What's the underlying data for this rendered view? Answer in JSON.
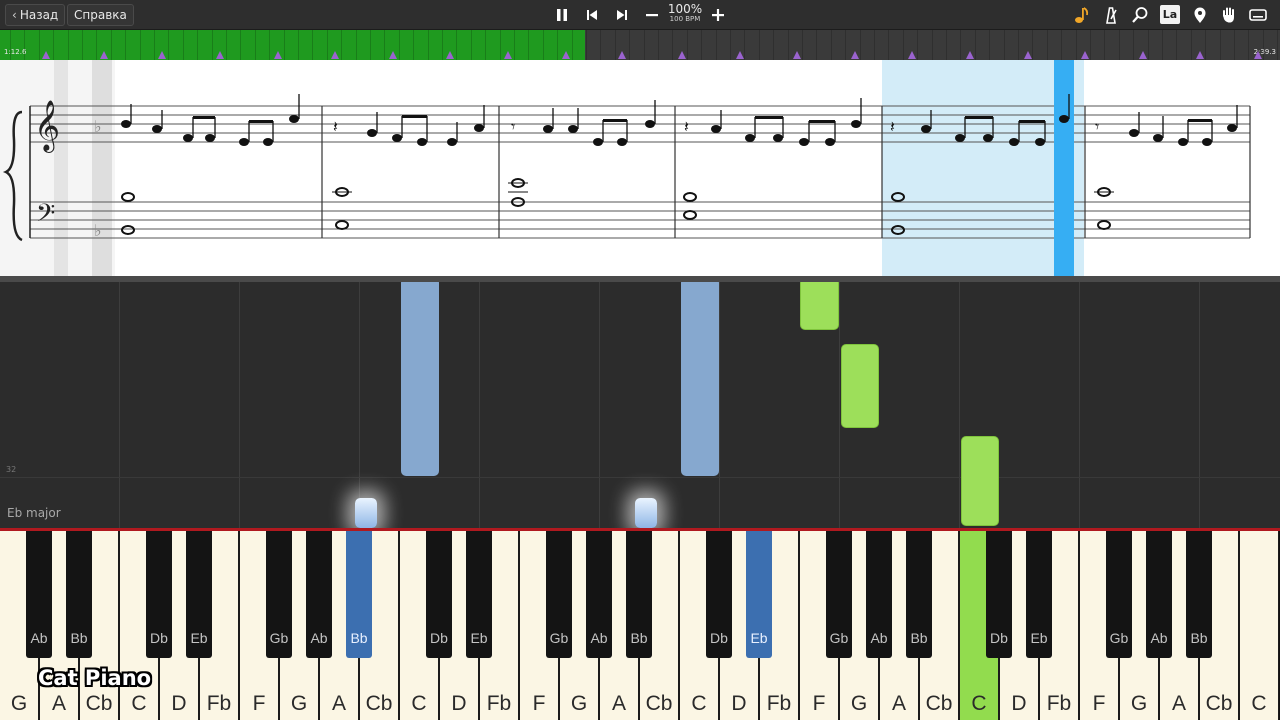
{
  "toolbar": {
    "back_label": "Назад",
    "help_label": "Справка",
    "speed_percent": "100%",
    "bpm": "100 BPM",
    "la_label": "La",
    "icons": [
      "pause-icon",
      "skip-back-icon",
      "skip-forward-icon",
      "minus-icon",
      "plus-icon",
      "note-icon",
      "metronome-icon",
      "search-icon",
      "la-icon",
      "pin-icon",
      "hand-icon",
      "keyboard-icon"
    ]
  },
  "timeline": {
    "start_time": "1:12.6",
    "end_time": "2:39.3",
    "progress": 0.457
  },
  "falls": {
    "key_signature": "Eb major",
    "measure_number": "32"
  },
  "keyboard": {
    "white_keys": [
      "G",
      "A",
      "Cb",
      "C",
      "D",
      "Fb",
      "F",
      "G",
      "A",
      "Cb",
      "C",
      "D",
      "Fb",
      "F",
      "G",
      "A",
      "Cb",
      "C",
      "D",
      "Fb",
      "F",
      "G",
      "A",
      "Cb",
      "C",
      "D",
      "Fb",
      "F",
      "G",
      "A",
      "Cb",
      "C"
    ],
    "black_keys": [
      {
        "after": 1,
        "label": "Ab"
      },
      {
        "after": 2,
        "label": "Bb"
      },
      {
        "after": 4,
        "label": "Db"
      },
      {
        "after": 5,
        "label": "Eb"
      },
      {
        "after": 7,
        "label": "Gb"
      },
      {
        "after": 8,
        "label": "Ab"
      },
      {
        "after": 9,
        "label": "Bb"
      },
      {
        "after": 11,
        "label": "Db"
      },
      {
        "after": 12,
        "label": "Eb"
      },
      {
        "after": 14,
        "label": "Gb"
      },
      {
        "after": 15,
        "label": "Ab"
      },
      {
        "after": 16,
        "label": "Bb"
      },
      {
        "after": 18,
        "label": "Db"
      },
      {
        "after": 19,
        "label": "Eb"
      },
      {
        "after": 21,
        "label": "Gb"
      },
      {
        "after": 22,
        "label": "Ab"
      },
      {
        "after": 23,
        "label": "Bb"
      },
      {
        "after": 25,
        "label": "Db"
      },
      {
        "after": 26,
        "label": "Eb"
      },
      {
        "after": 28,
        "label": "Gb"
      },
      {
        "after": 29,
        "label": "Ab"
      },
      {
        "after": 30,
        "label": "Bb"
      }
    ],
    "active_white": [
      24
    ],
    "active_black": [
      6,
      13
    ]
  },
  "watermark": "Cat Piano",
  "colors": {
    "progress_green": "#1f9a1f",
    "left_hand_blue": "#86a8cf",
    "right_hand_green": "#9ddf5a",
    "highlight_blue": "#36aef3",
    "selection_blue": "#d3ecf8"
  }
}
